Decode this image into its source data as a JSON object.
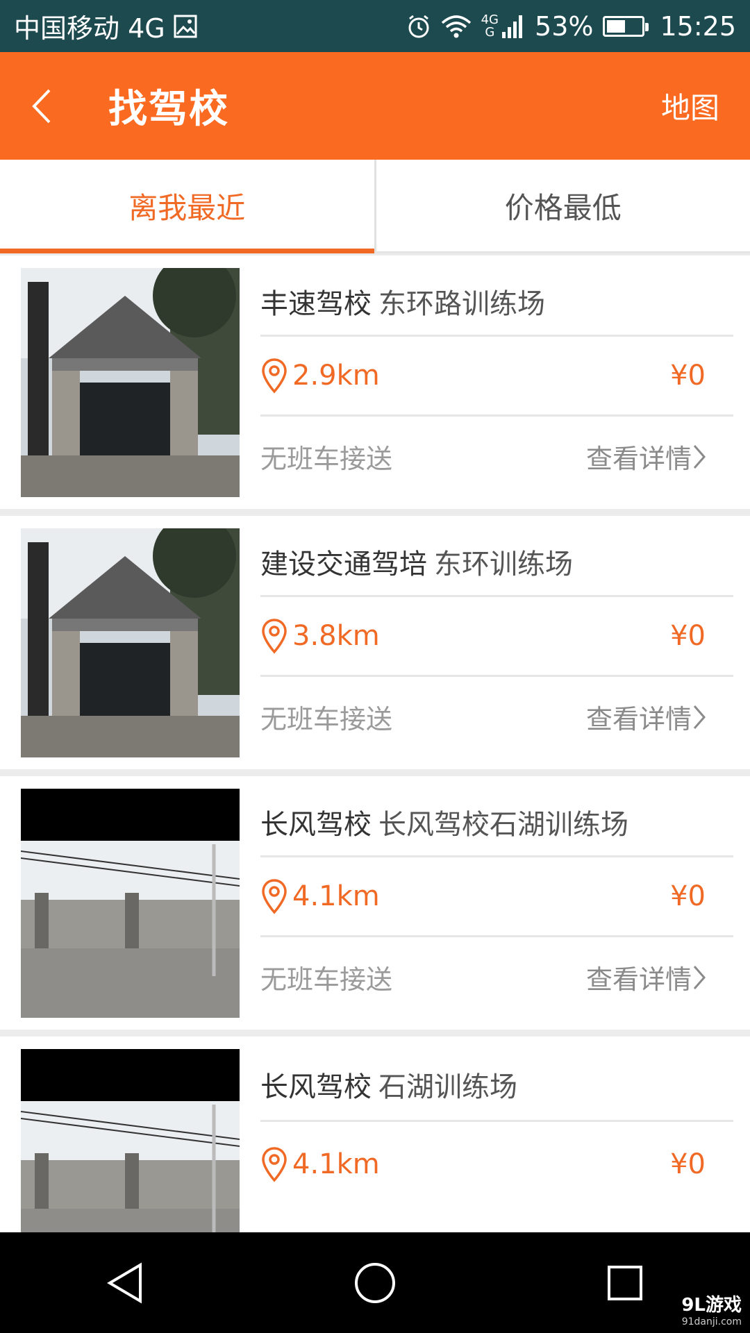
{
  "status_bar": {
    "carrier": "中国移动 4G",
    "net_top": "4G",
    "net_bottom": "G",
    "battery_percent": "53%",
    "battery_level": 0.53,
    "time": "15:25"
  },
  "app_bar": {
    "title": "找驾校",
    "map_label": "地图"
  },
  "tabs": [
    {
      "label": "离我最近",
      "active": true
    },
    {
      "label": "价格最低",
      "active": false
    }
  ],
  "schools": [
    {
      "name": "丰速驾校",
      "campus": "东环路训练场",
      "distance": "2.9km",
      "price": "¥0",
      "shuttle": "无班车接送",
      "detail": "查看详情",
      "photo": "gate-icon"
    },
    {
      "name": "建设交通驾培",
      "campus": "东环训练场",
      "distance": "3.8km",
      "price": "¥0",
      "shuttle": "无班车接送",
      "detail": "查看详情",
      "photo": "gate-icon"
    },
    {
      "name": "长风驾校",
      "campus": "长风驾校石湖训练场",
      "distance": "4.1km",
      "price": "¥0",
      "shuttle": "无班车接送",
      "detail": "查看详情",
      "photo": "yard-icon"
    },
    {
      "name": "长风驾校",
      "campus": "石湖训练场",
      "distance": "4.1km",
      "price": "¥0",
      "shuttle": "",
      "detail": "",
      "photo": "yard-icon"
    }
  ],
  "watermark": {
    "main": "9L游戏",
    "sub": "91danji.com"
  },
  "colors": {
    "accent": "#fb6a21",
    "status_bar": "#1d4a4f"
  }
}
